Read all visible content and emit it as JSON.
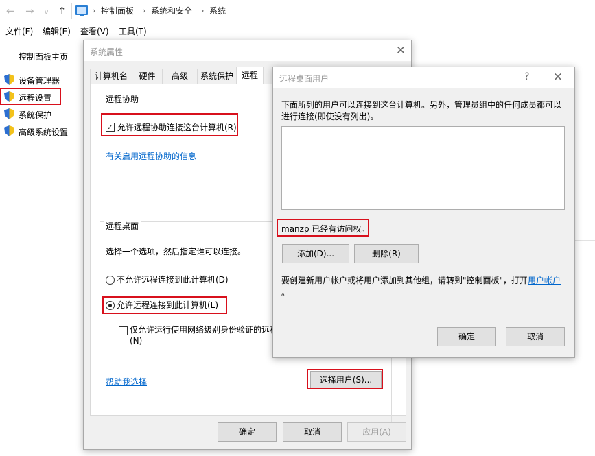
{
  "explorer": {
    "breadcrumb": [
      "控制面板",
      "系统和安全",
      "系统"
    ],
    "menu": [
      "文件(F)",
      "编辑(E)",
      "查看(V)",
      "工具(T)"
    ],
    "left_home": "控制面板主页",
    "left_links": [
      "设备管理器",
      "远程设置",
      "系统保护",
      "高级系统设置"
    ]
  },
  "sysprops": {
    "title": "系统属性",
    "tabs": [
      "计算机名",
      "硬件",
      "高级",
      "系统保护",
      "远程"
    ],
    "active_tab": "远程",
    "remote_assist": {
      "group_title": "远程协助",
      "allow_label": "允许远程协助连接这台计算机(R)",
      "allow_checked": true,
      "info_link": "有关启用远程协助的信息"
    },
    "remote_desktop": {
      "group_title": "远程桌面",
      "instruction": "选择一个选项，然后指定谁可以连接。",
      "option_deny": "不允许远程连接到此计算机(D)",
      "option_allow": "允许远程连接到此计算机(L)",
      "selected": "allow",
      "nla_label_line1": "仅允许运行使用网络级别身份验证的远程",
      "nla_label_line2": "(N)",
      "nla_checked": false,
      "help_link": "帮助我选择",
      "select_users_button": "选择用户(S)..."
    },
    "buttons": {
      "ok": "确定",
      "cancel": "取消",
      "apply": "应用(A)"
    }
  },
  "rdusers": {
    "title": "远程桌面用户",
    "help": "?",
    "description_line1": "下面所列的用户可以连接到这台计算机。另外，管理员组中的任何成员都可以",
    "description_line2": "进行连接(即使没有列出)。",
    "users": [],
    "access_note": "manzp 已经有访问权。",
    "add_button": "添加(D)...",
    "remove_button": "删除(R)",
    "create_note": "要创建新用户帐户或将用户添加到其他组，请转到\"控制面板\"，打开",
    "create_link": "用户帐户",
    "create_note_end": "。",
    "buttons": {
      "ok": "确定",
      "cancel": "取消"
    }
  },
  "colors": {
    "highlight_box": "#d8101c",
    "link": "#0066cc"
  }
}
